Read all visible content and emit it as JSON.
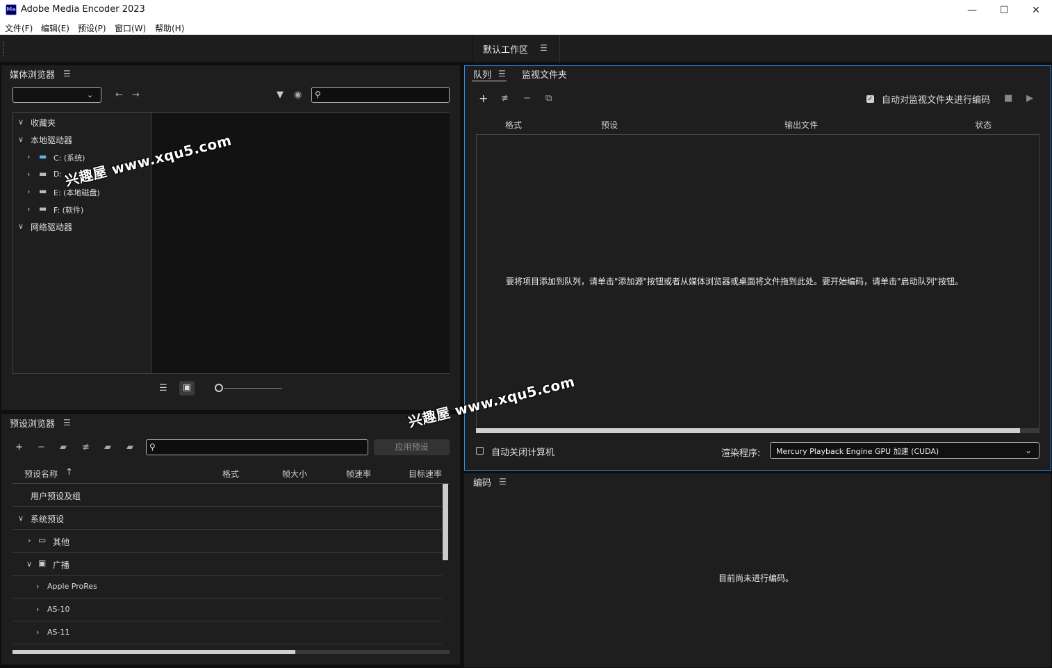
{
  "window": {
    "logo": "Me",
    "title": "Adobe Media Encoder 2023",
    "controls": {
      "minimize": "—",
      "maximize": "☐",
      "close": "✕"
    }
  },
  "menu": [
    "文件(F)",
    "编辑(E)",
    "预设(P)",
    "窗口(W)",
    "帮助(H)"
  ],
  "workspace": {
    "label": "默认工作区"
  },
  "media_browser": {
    "title": "媒体浏览器",
    "search_placeholder": "",
    "tree": [
      {
        "label": "收藏夹"
      },
      {
        "label": "本地驱动器"
      },
      {
        "label": "C: (系统)"
      },
      {
        "label": "D:"
      },
      {
        "label": "E: (本地磁盘)"
      },
      {
        "label": "F: (软件)"
      },
      {
        "label": "网络驱动器"
      }
    ]
  },
  "preset_browser": {
    "title": "预设浏览器",
    "apply_label": "应用预设",
    "columns": [
      "预设名称",
      "格式",
      "帧大小",
      "帧速率",
      "目标速率"
    ],
    "rows": [
      {
        "label": "用户预设及组"
      },
      {
        "label": "系统预设"
      },
      {
        "label": "其他"
      },
      {
        "label": "广播"
      },
      {
        "label": "Apple ProRes"
      },
      {
        "label": "AS-10"
      },
      {
        "label": "AS-11"
      }
    ]
  },
  "queue": {
    "tabs": [
      "队列",
      "监视文件夹"
    ],
    "auto_encode_label": "自动对监视文件夹进行编码",
    "columns": [
      "格式",
      "预设",
      "输出文件",
      "状态"
    ],
    "empty_message": "要将项目添加到队列，请单击\"添加源\"按钮或者从媒体浏览器或桌面将文件拖到此处。要开始编码，请单击\"启动队列\"按钮。",
    "auto_shutdown_label": "自动关闭计算机",
    "renderer_label": "渲染程序:",
    "renderer_value": "Mercury Playback Engine GPU 加速 (CUDA)"
  },
  "encoding": {
    "title": "编码",
    "empty_message": "目前尚未进行编码。"
  },
  "watermarks": [
    "兴趣屋 www.xqu5.com",
    "兴趣屋 www.xqu5.com"
  ],
  "colors": {
    "accent": "#2d8ceb",
    "panel": "#1e1e1e",
    "background": "#0e0e0e"
  }
}
